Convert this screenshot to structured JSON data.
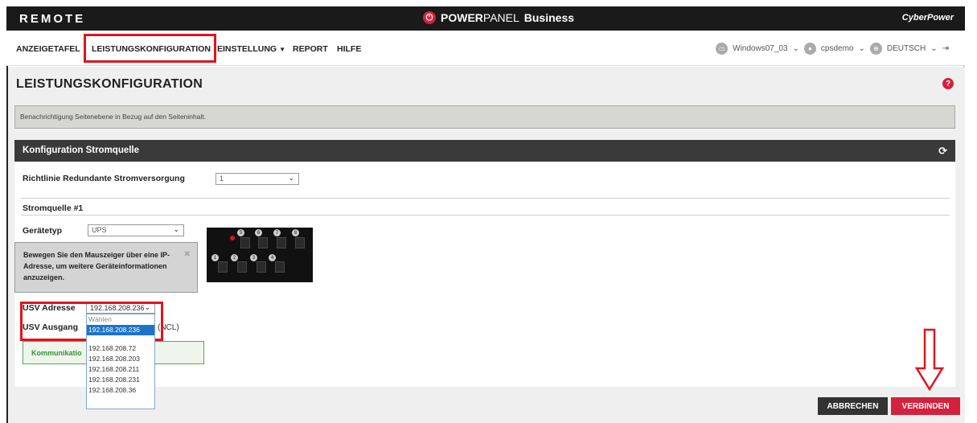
{
  "header": {
    "brand_left": "REMOTE",
    "brand_center_1": "POWER",
    "brand_center_2": "PANEL",
    "brand_center_3": "Business",
    "brand_right": "CyberPower"
  },
  "nav": {
    "items": [
      {
        "label": "ANZEIGETAFEL"
      },
      {
        "label": "LEISTUNGSKONFIGURATION"
      },
      {
        "label": "EINSTELLUNG"
      },
      {
        "label": "REPORT"
      },
      {
        "label": "HILFE"
      }
    ],
    "right": {
      "device": "Windows07_03",
      "user": "cpsdemo",
      "language": "DEUTSCH"
    }
  },
  "page": {
    "title": "LEISTUNGSKONFIGURATION",
    "notice": "Benachrichtigung Seitenebene in Bezug auf den Seiteninhalt."
  },
  "panel": {
    "title": "Konfiguration Stromquelle",
    "redundancy_label": "Richtlinie Redundante Stromversorgung",
    "redundancy_value": "1",
    "source_title": "Stromquelle #1",
    "device_type_label": "Gerätetyp",
    "device_type_value": "UPS",
    "info_text": "Bewegen Sie den Mauszeiger über eine IP-Adresse, um weitere Geräteinformationen anzuzeigen.",
    "outlet_numbers_top": [
      "5",
      "6",
      "7",
      "8"
    ],
    "outlet_numbers_bottom": [
      "1",
      "2",
      "3",
      "4"
    ],
    "usv_address_label": "USV Adresse",
    "usv_address_value": "192.168.208.236",
    "usv_output_label": "USV Ausgang",
    "usv_output_suffix": "(NCL)",
    "comm_text": "Kommunikatio",
    "dropdown_options": [
      "Wählen",
      "192.168.208.236",
      "192.168.208.72",
      "192.168.208.203",
      "192.168.208.211",
      "192.168.208.231",
      "192.168.208.36"
    ]
  },
  "buttons": {
    "cancel": "ABBRECHEN",
    "connect": "VERBINDEN"
  },
  "colors": {
    "accent": "#d4213d",
    "highlight": "#e0141e",
    "dark": "#1a1a1a"
  }
}
